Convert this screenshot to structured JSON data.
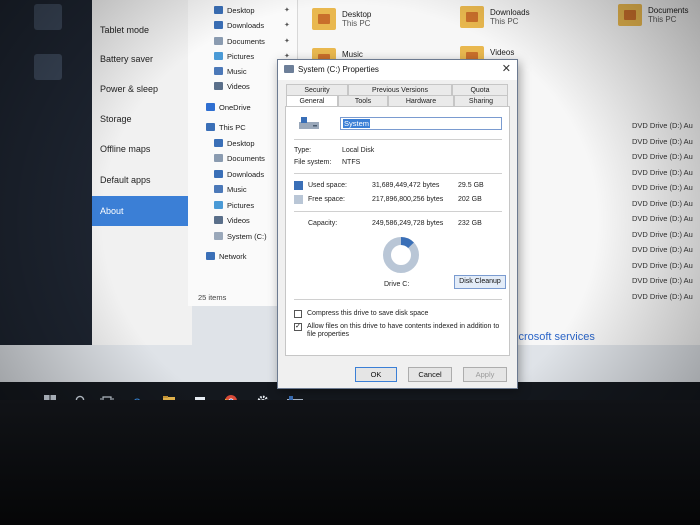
{
  "settings_nav": {
    "items": [
      "Tablet mode",
      "Battery saver",
      "Power & sleep",
      "Storage",
      "Offline maps",
      "Default apps",
      "About"
    ],
    "active": "About"
  },
  "explorer": {
    "tree": [
      {
        "label": "Desktop",
        "icon": "desktop-icon",
        "pinned": true
      },
      {
        "label": "Downloads",
        "icon": "downloads-icon",
        "pinned": true
      },
      {
        "label": "Documents",
        "icon": "documents-icon",
        "pinned": true
      },
      {
        "label": "Pictures",
        "icon": "pictures-icon",
        "pinned": true
      },
      {
        "label": "Music",
        "icon": "music-icon",
        "pinned": false
      },
      {
        "label": "Videos",
        "icon": "videos-icon",
        "pinned": false
      },
      {
        "label": "OneDrive",
        "icon": "onedrive-icon",
        "pinned": false
      },
      {
        "label": "This PC",
        "icon": "this-pc-icon",
        "pinned": false
      },
      {
        "label": "Desktop",
        "icon": "desktop-icon",
        "pinned": false
      },
      {
        "label": "Documents",
        "icon": "documents-icon",
        "pinned": false
      },
      {
        "label": "Downloads",
        "icon": "downloads-icon",
        "pinned": false
      },
      {
        "label": "Music",
        "icon": "music-icon",
        "pinned": false
      },
      {
        "label": "Pictures",
        "icon": "pictures-icon",
        "pinned": false
      },
      {
        "label": "Videos",
        "icon": "videos-icon",
        "pinned": false
      },
      {
        "label": "System (C:)",
        "icon": "drive-icon",
        "pinned": false
      },
      {
        "label": "Network",
        "icon": "network-icon",
        "pinned": false
      }
    ],
    "items_count": "25 items"
  },
  "content": {
    "folders": [
      {
        "name": "Desktop",
        "sub": "This PC"
      },
      {
        "name": "Downloads",
        "sub": "This PC"
      },
      {
        "name": "Documents",
        "sub": "This PC"
      },
      {
        "name": "Music",
        "sub": ""
      },
      {
        "name": "Videos",
        "sub": ""
      }
    ],
    "dvd_rows": [
      "DVD Drive (D:) Au",
      "DVD Drive (D:) Au",
      "DVD Drive (D:) Au",
      "DVD Drive (D:) Au",
      "DVD Drive (D:) Au",
      "DVD Drive (D:) Au",
      "DVD Drive (D:) Au",
      "DVD Drive (D:) Au",
      "DVD Drive (D:) Au",
      "DVD Drive (D:) Au",
      "DVD Drive (D:) Au",
      "DVD Drive (D:) Au"
    ],
    "ms_services": "icrosoft services"
  },
  "dialog": {
    "title": "System (C:) Properties",
    "close": "✕",
    "tabs_row1": [
      "Security",
      "Previous Versions",
      "Quota"
    ],
    "tabs_row2": [
      "General",
      "Tools",
      "Hardware",
      "Sharing"
    ],
    "selected_tab": "General",
    "drive_name": "System",
    "type_label": "Type:",
    "type_value": "Local Disk",
    "fs_label": "File system:",
    "fs_value": "NTFS",
    "used_label": "Used space:",
    "used_bytes": "31,689,449,472 bytes",
    "used_gb": "29.5 GB",
    "free_label": "Free space:",
    "free_bytes": "217,896,800,256 bytes",
    "free_gb": "202 GB",
    "capacity_label": "Capacity:",
    "capacity_bytes": "249,586,249,728 bytes",
    "capacity_gb": "232 GB",
    "used_fraction": 0.127,
    "drive_label": "Drive C:",
    "disk_cleanup": "Disk Cleanup",
    "compress_label": "Compress this drive to save disk space",
    "compress_checked": false,
    "index_label_1": "Allow files on this drive to have contents indexed in addition to",
    "index_label_2": "file properties",
    "index_checked": true,
    "check_mark": "✓",
    "ok": "OK",
    "cancel": "Cancel",
    "apply": "Apply",
    "used_color": "#3a6fb7",
    "free_color": "#b9c6d6"
  }
}
